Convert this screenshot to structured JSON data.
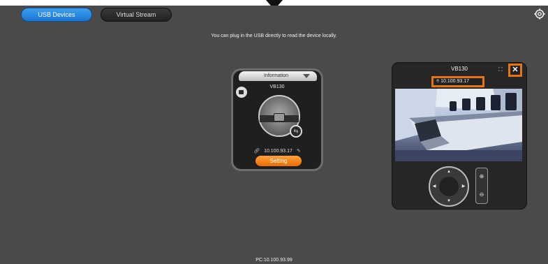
{
  "tabs": [
    {
      "label": "USB Devices",
      "active": true
    },
    {
      "label": "Virtual Stream",
      "active": false
    }
  ],
  "hint": "You can plug in the USB directly to read the device locally.",
  "info_card": {
    "header": "Information",
    "model": "VB130",
    "ip": "10.100.93.17",
    "setting_label": "Setting"
  },
  "stream_panel": {
    "title": "VB130",
    "ip": "10.100.93.17"
  },
  "footer": "PC:10.100.93.99",
  "colors": {
    "accent_blue": "#1a74d0",
    "highlight_orange": "#e87410",
    "setting_orange": "#f08a18",
    "background": "#4a4a4a"
  },
  "icons": [
    "settings-gear-icon",
    "camera-icon",
    "connect-icon",
    "link-icon",
    "edit-icon",
    "expand-icon",
    "close-icon",
    "location-pin-icon",
    "arrow-up-icon",
    "arrow-down-icon",
    "arrow-left-icon",
    "arrow-right-icon",
    "zoom-in-icon",
    "zoom-out-icon"
  ]
}
